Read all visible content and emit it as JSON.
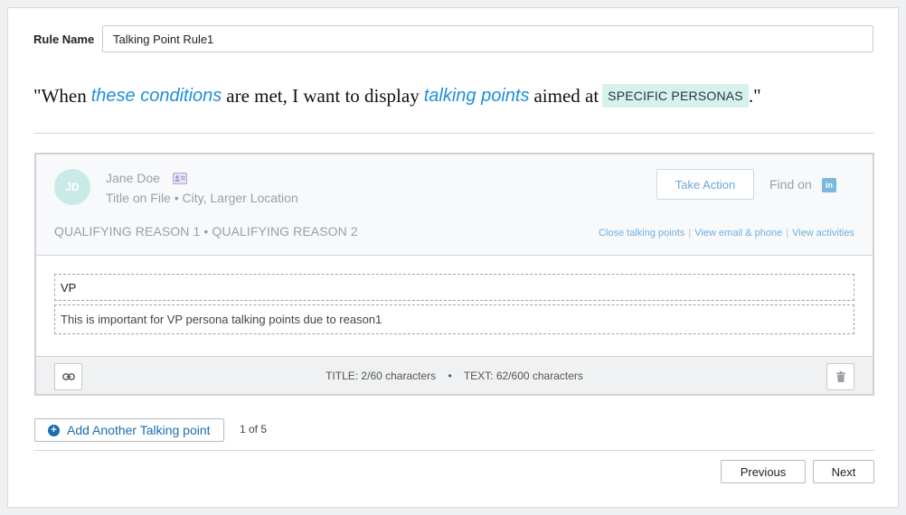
{
  "rule": {
    "label": "Rule Name",
    "value": "Talking Point Rule1"
  },
  "sentence": {
    "open_quote": "\"When",
    "conditions_link": "these conditions",
    "mid1": "are met, I want to display",
    "talking_points_link": "talking points",
    "mid2": "aimed at",
    "persona_chip": "SPECIFIC PERSONAS",
    "close_quote": ".\""
  },
  "preview": {
    "avatar_initials": "JD",
    "name": "Jane Doe",
    "title_line": "Title on File • City, Larger Location",
    "take_action_label": "Take Action",
    "find_on_label": "Find on",
    "linkedin_glyph": "in",
    "reasons": "QUALIFYING REASON 1 • QUALIFYING REASON 2",
    "links": [
      "Close talking points",
      "View email & phone",
      "View activities"
    ],
    "link_separator": "|"
  },
  "talking_point": {
    "title": "VP",
    "text": "This is important for VP persona talking points due to reason1",
    "title_count": "TITLE: 2/60 characters",
    "count_separator": "•",
    "text_count": "TEXT: 62/600 characters"
  },
  "footer": {
    "add_label": "Add Another Talking point",
    "add_glyph": "+",
    "page_count": "1 of 5",
    "previous_label": "Previous",
    "next_label": "Next"
  },
  "colors": {
    "accent_blue": "#1f8fdc",
    "button_blue": "#1a6fb3",
    "persona_chip_bg": "#d6f1ee",
    "avatar_bg": "#c8ebe7"
  },
  "icons": {
    "vcard": "vcard-icon",
    "linkedin": "linkedin-icon",
    "link": "link-icon",
    "trash": "trash-icon",
    "plus": "plus-circle-icon"
  }
}
